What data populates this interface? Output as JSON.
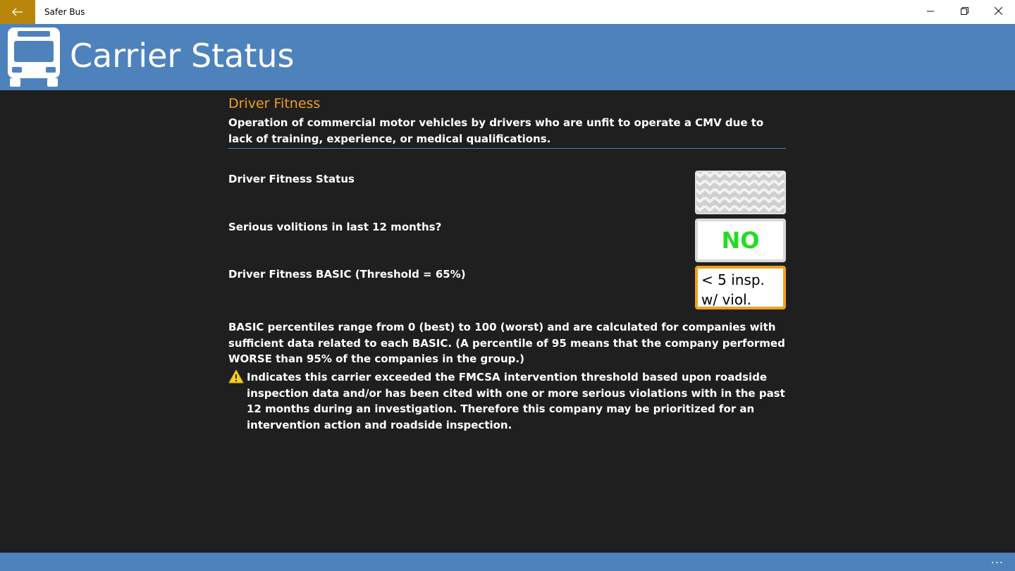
{
  "window": {
    "app_title": "Safer Bus",
    "back_icon": "arrow-left-icon",
    "controls": [
      "minimize-icon",
      "restore-icon",
      "close-icon"
    ]
  },
  "header": {
    "logo_icon": "bus-icon",
    "title": "Carrier Status",
    "background_color": "#4d82bd"
  },
  "section": {
    "title": "Driver Fitness",
    "description": "Operation of commercial motor vehicles by drivers who are unfit to operate a CMV due to lack of training, experience, or medical qualifications.",
    "title_color": "#f0a020"
  },
  "rows": [
    {
      "label": "Driver Fitness Status",
      "value": "",
      "tile": "hatched-status-icon"
    },
    {
      "label": "Serious volitions in last 12 months?",
      "value": "NO",
      "value_color": "#22dd22"
    },
    {
      "label": "Driver Fitness BASIC (Threshold = 65%)",
      "value": "< 5 insp. w/ viol.",
      "border_color": "#f0a020"
    }
  ],
  "notes": {
    "percentile_text": "BASIC percentiles range from 0 (best) to 100 (worst) and are calculated for companies with sufficient data related to each BASIC. (A percentile of 95 means that the company performed WORSE than 95% of the companies in the group.)",
    "warning_icon": "warning-triangle-icon",
    "warning_text": "Indicates this carrier exceeded the FMCSA intervention threshold based upon roadside inspection data and/or has been cited with one or more serious violations with in the past 12 months during an investigation. Therefore this company may be prioritized for an intervention action and roadside inspection."
  },
  "bottom_bar": {
    "more_label": "..."
  }
}
